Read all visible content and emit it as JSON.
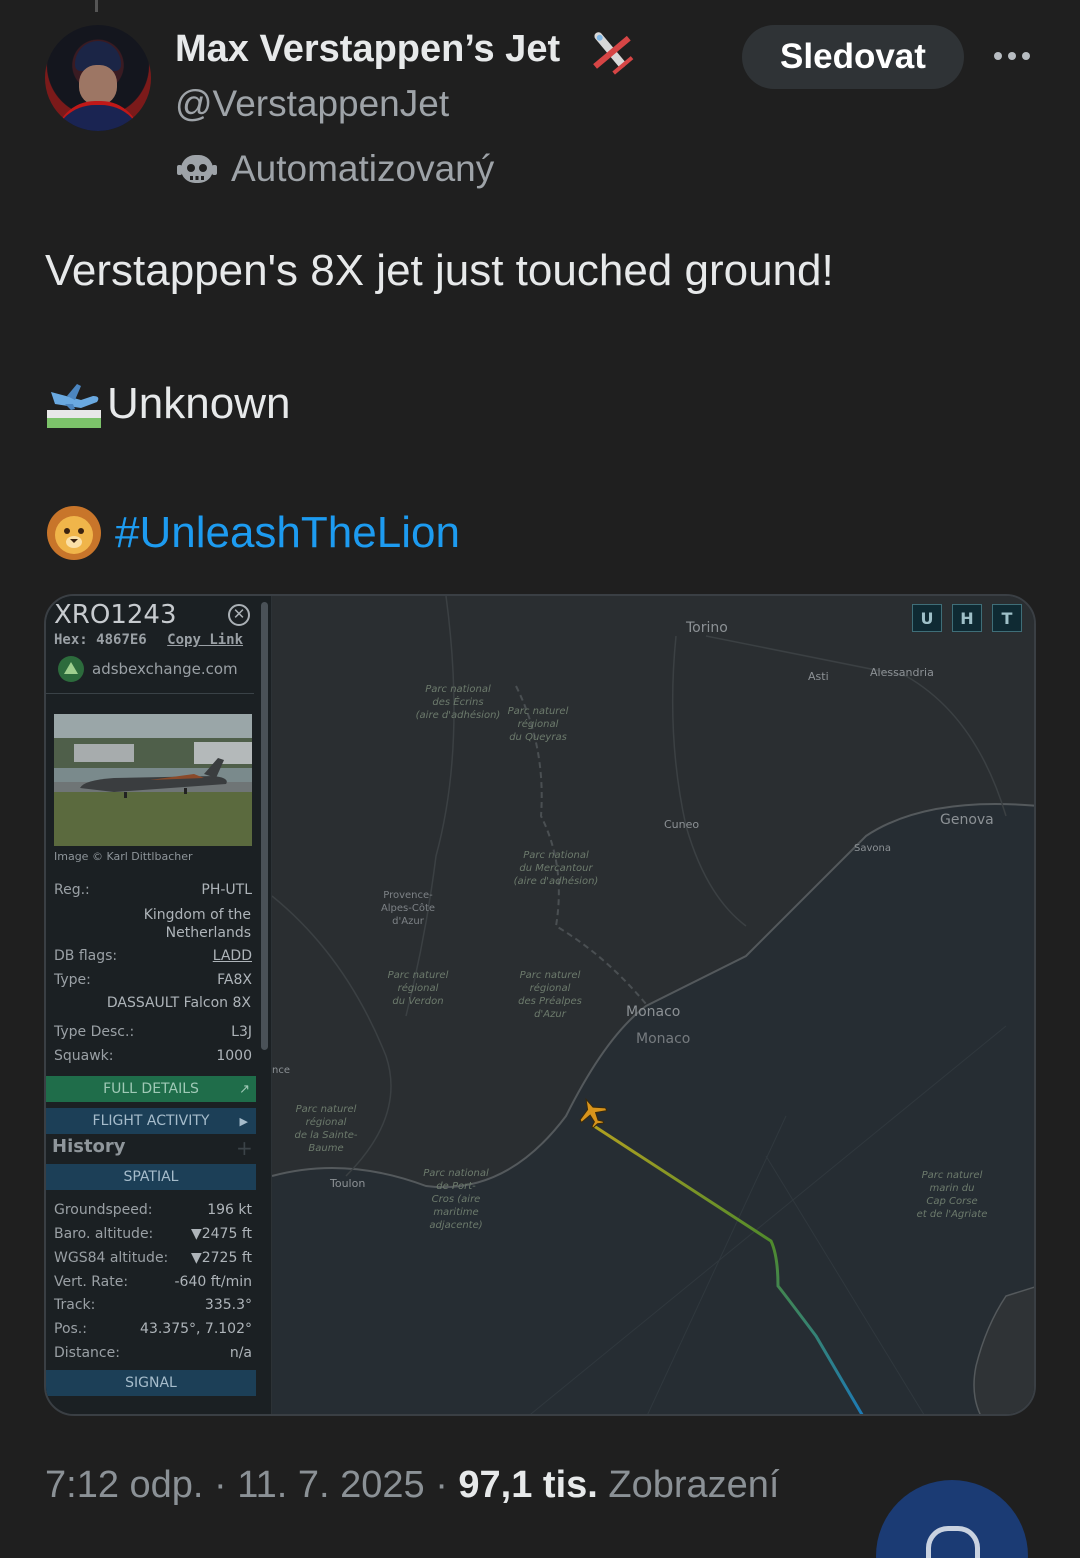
{
  "author": {
    "display_name": "Max Verstappen’s Jet",
    "handle": "@VerstappenJet",
    "automated_label": "Automatizovaný",
    "badge_icon": "airplane-icon"
  },
  "actions": {
    "follow_label": "Sledovat",
    "more_icon": "more-icon"
  },
  "tweet": {
    "line1": "Verstappen's 8X jet just touched ground!",
    "line2_emoji": "airplane-arriving-icon",
    "line2": "Unknown",
    "line3_emoji": "lion-face-icon",
    "hashtag": "#UnleashTheLion"
  },
  "media": {
    "sidebar": {
      "callsign": "XRO1243",
      "hex_label": "Hex:",
      "hex_value": "4867E6",
      "copy_link": "Copy Link",
      "source": "adsbexchange.com",
      "image_credit": "Image © Karl Dittlbacher",
      "reg_label": "Reg.:",
      "reg_value": "PH-UTL",
      "country": "Kingdom of the Netherlands",
      "db_flags_label": "DB flags:",
      "db_flags_value": "LADD",
      "type_label": "Type:",
      "type_value": "FA8X",
      "type_name": "DASSAULT Falcon 8X",
      "type_desc_label": "Type Desc.:",
      "type_desc_value": "L3J",
      "squawk_label": "Squawk:",
      "squawk_value": "1000",
      "full_details": "FULL DETAILS",
      "flight_activity": "FLIGHT ACTIVITY",
      "history": "History",
      "spatial": "SPATIAL",
      "groundspeed_label": "Groundspeed:",
      "groundspeed_value": "196 kt",
      "baro_label": "Baro. altitude:",
      "baro_value": "▼2475 ft",
      "wgs_label": "WGS84 altitude:",
      "wgs_value": "▼2725 ft",
      "vert_label": "Vert. Rate:",
      "vert_value": "-640 ft/min",
      "track_label": "Track:",
      "track_value": "335.3°",
      "pos_label": "Pos.:",
      "pos_value": "43.375°, 7.102°",
      "distance_label": "Distance:",
      "distance_value": "n/a",
      "signal": "SIGNAL"
    },
    "map_buttons": [
      "U",
      "H",
      "T"
    ],
    "map_labels": {
      "torino": "Torino",
      "asti": "Asti",
      "alessandria": "Alessandria",
      "genova": "Genova",
      "savona": "Savona",
      "cuneo": "Cuneo",
      "monaco1": "Monaco",
      "monaco2": "Monaco",
      "toulon": "Toulon",
      "nce": "nce",
      "provence": [
        "Provence-",
        "Alpes-Côte",
        "d'Azur"
      ],
      "ecrins": [
        "Parc national",
        "des Écrins",
        "(aire d'adhésion)"
      ],
      "queyras": [
        "Parc naturel",
        "régional",
        "du Queyras"
      ],
      "mercantour": [
        "Parc national",
        "du Mercantour",
        "(aire d'adhésion)"
      ],
      "verdon": [
        "Parc naturel",
        "régional",
        "du Verdon"
      ],
      "prealpes": [
        "Parc naturel",
        "régional",
        "des Préalpes",
        "d'Azur"
      ],
      "sainte_baume": [
        "Parc naturel",
        "régional",
        "de la Sainte-",
        "Baume"
      ],
      "port_cros": [
        "Parc national",
        "de Port-",
        "Cros (aire",
        "maritime",
        "adjacente)"
      ],
      "cap_corse": [
        "Parc naturel",
        "marin du",
        "Cap Corse",
        "et de l'Agriate"
      ]
    }
  },
  "footer": {
    "time": "7:12 odp.",
    "sep1": "·",
    "date": "11. 7. 2025",
    "sep2": "·",
    "views_count": "97,1 tis.",
    "views_label": "Zobrazení"
  },
  "colors": {
    "background": "#1f1f1f",
    "hashtag": "#1d9bf0",
    "follow_bg": "#2f3336",
    "track_start": "#b0a020",
    "track_end": "#1c7ab8"
  }
}
